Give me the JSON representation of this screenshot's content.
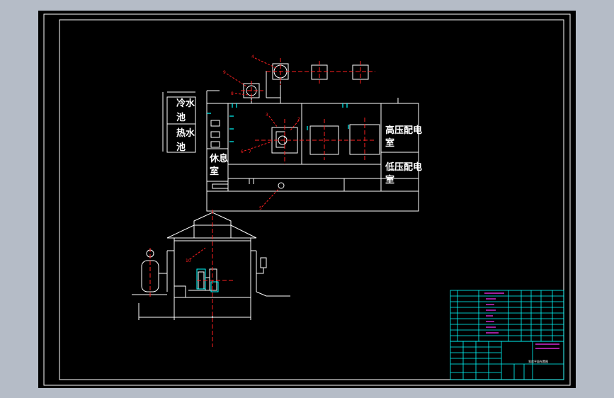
{
  "drawing": {
    "rooms": {
      "cold_pool_line1": "冷水",
      "cold_pool_line2": "池",
      "hot_pool_line1": "热水",
      "hot_pool_line2": "池",
      "rest_room_line1": "休息",
      "rest_room_line2": "室",
      "hv_room_line1": "高压配电",
      "hv_room_line2": "室",
      "lv_room_line1": "低压配电",
      "lv_room_line2": "室"
    },
    "markers": [
      "1",
      "2",
      "3",
      "4",
      "5",
      "6",
      "7",
      "8",
      "9",
      "10"
    ],
    "title_block": {
      "drawing_title": "泵房平面布置图"
    }
  },
  "colors": {
    "paper": "#000000",
    "outer_bg": "#b5bcc7",
    "line_white": "#ffffff",
    "centerline_red": "#ff2020",
    "cyan": "#00ffff",
    "magenta": "#ff33ff",
    "yellow": "#ffff40"
  }
}
